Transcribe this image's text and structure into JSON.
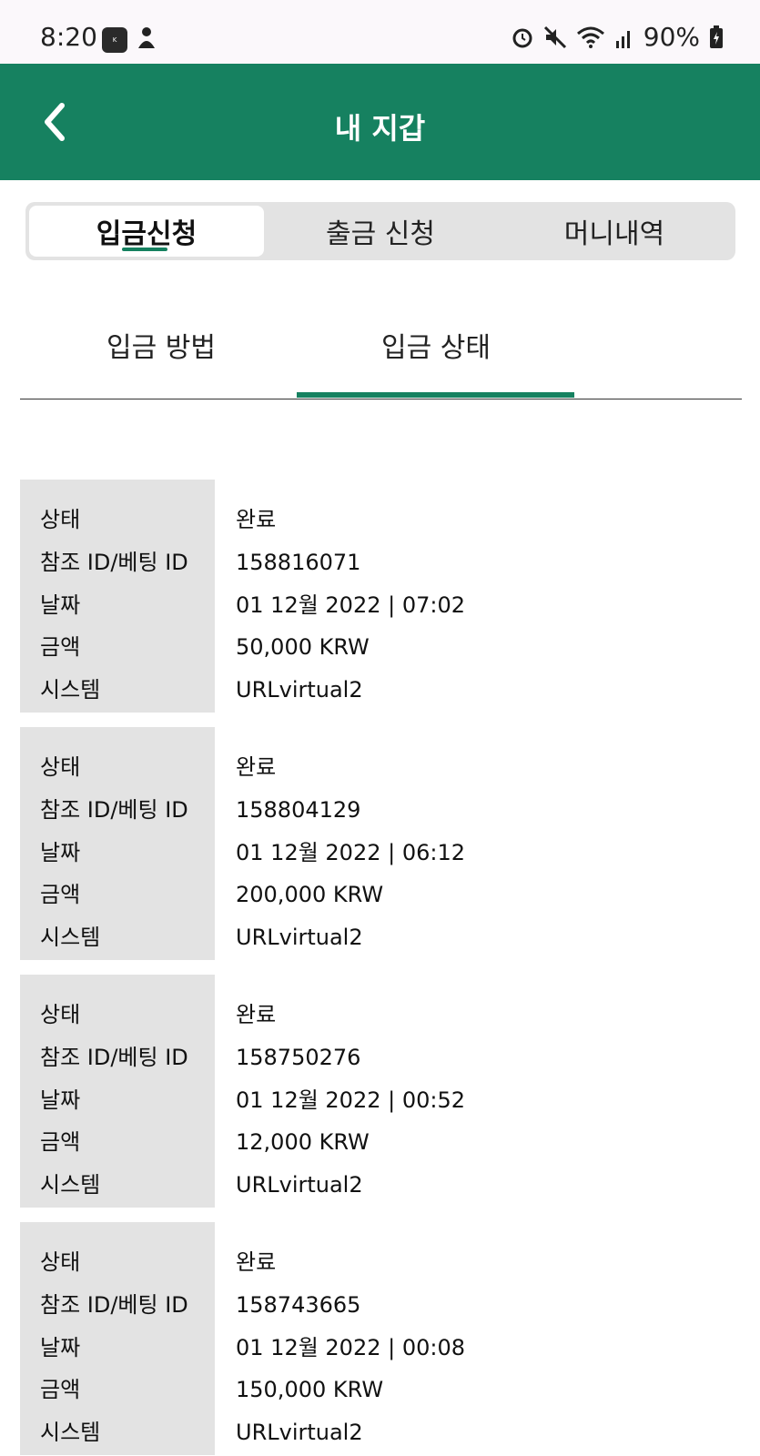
{
  "status_bar": {
    "time": "8:20",
    "battery": "90%",
    "icons": [
      "kbank-icon",
      "person-icon",
      "alarm-icon",
      "mute-icon",
      "wifi-icon",
      "signal-icon",
      "battery-charging-icon"
    ]
  },
  "app_bar": {
    "title": "내 지갑",
    "back_icon": "chevron-left-icon"
  },
  "segmented_tabs": [
    {
      "label": "입금신청",
      "active": true
    },
    {
      "label": "출금 신청",
      "active": false
    },
    {
      "label": "머니내역",
      "active": false
    }
  ],
  "sub_tabs": [
    {
      "label": "입금 방법",
      "active": false
    },
    {
      "label": "입금 상태",
      "active": true
    }
  ],
  "field_labels": {
    "status": "상태",
    "ref_id": "참조 ID/베팅 ID",
    "date": "날짜",
    "amount": "금액",
    "system": "시스템"
  },
  "records": [
    {
      "status": "완료",
      "ref_id": "158816071",
      "date": "01 12월 2022 | 07:02",
      "amount": "50,000 KRW",
      "system": "URLvirtual2"
    },
    {
      "status": "완료",
      "ref_id": "158804129",
      "date": "01 12월 2022 | 06:12",
      "amount": "200,000 KRW",
      "system": "URLvirtual2"
    },
    {
      "status": "완료",
      "ref_id": "158750276",
      "date": "01 12월 2022 | 00:52",
      "amount": "12,000 KRW",
      "system": "URLvirtual2"
    },
    {
      "status": "완료",
      "ref_id": "158743665",
      "date": "01 12월 2022 | 00:08",
      "amount": "150,000 KRW",
      "system": "URLvirtual2"
    }
  ],
  "colors": {
    "brand_green": "#168160",
    "label_bg": "#e3e3e3",
    "segment_bg": "#e3e3e3"
  }
}
